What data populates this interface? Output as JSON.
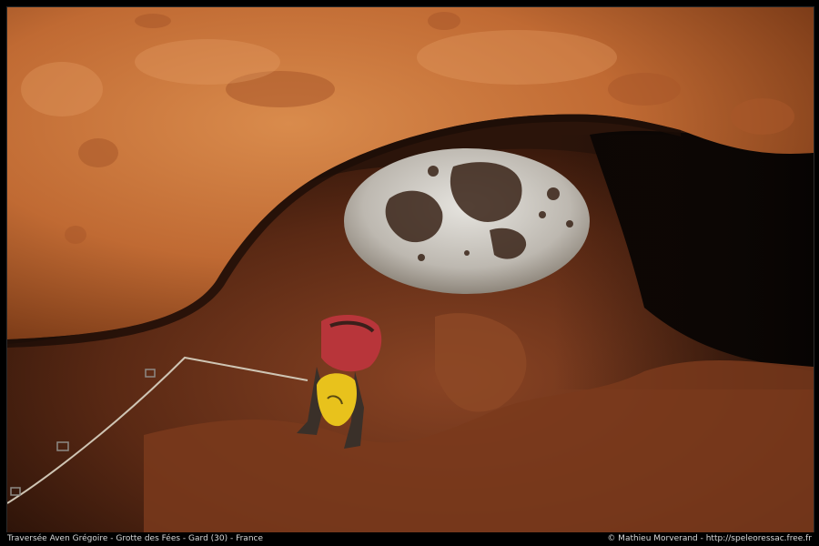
{
  "image": {
    "subject": "cave-photograph",
    "colors": {
      "frame": "#000000",
      "rock_ceiling": "#c9763a",
      "rock_shadow": "#4a2312",
      "calcite": "#c9c6c0",
      "harness_red": "#b8353a",
      "bag_yellow": "#e8c21c"
    }
  },
  "caption": {
    "left": "Traversée Aven Grégoire - Grotte des Fées - Gard (30) - France",
    "right": "© Mathieu Morverand - http://speleoressac.free.fr"
  }
}
